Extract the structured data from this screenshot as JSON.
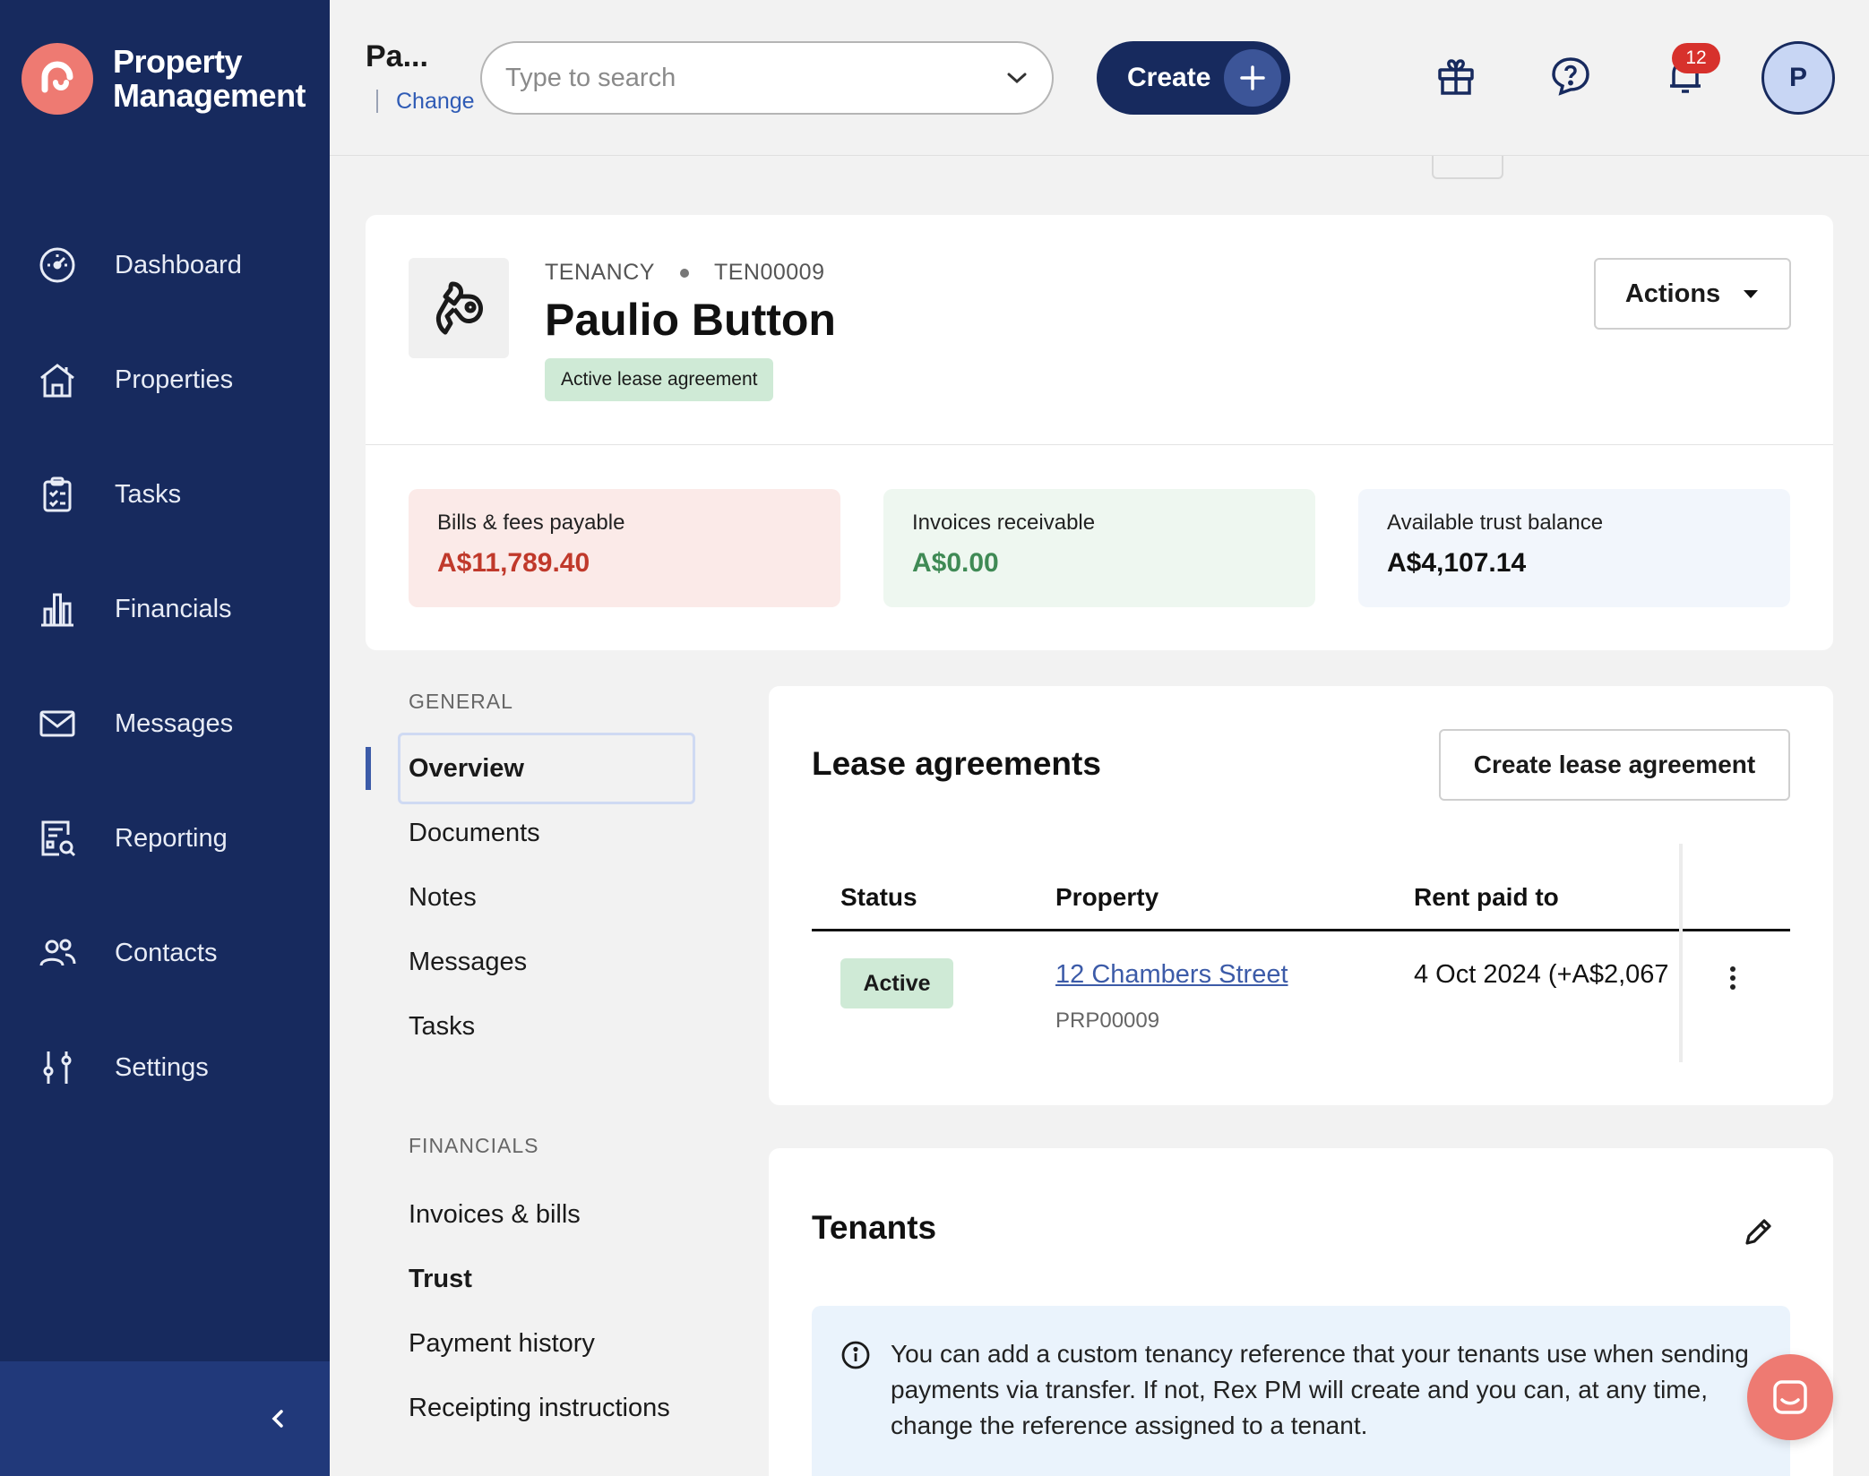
{
  "brand": {
    "line1": "Property",
    "line2": "Management"
  },
  "sidebar": {
    "items": [
      {
        "label": "Dashboard",
        "icon": "dashboard-icon"
      },
      {
        "label": "Properties",
        "icon": "house-icon"
      },
      {
        "label": "Tasks",
        "icon": "clipboard-icon"
      },
      {
        "label": "Financials",
        "icon": "bar-chart-icon"
      },
      {
        "label": "Messages",
        "icon": "envelope-icon"
      },
      {
        "label": "Reporting",
        "icon": "report-search-icon"
      },
      {
        "label": "Contacts",
        "icon": "people-icon"
      },
      {
        "label": "Settings",
        "icon": "sliders-icon"
      }
    ]
  },
  "header": {
    "context_title": "Pa...",
    "context_change": "Change",
    "search_placeholder": "Type to search",
    "create_label": "Create",
    "notification_count": "12",
    "avatar_initial": "P"
  },
  "record": {
    "type": "TENANCY",
    "code": "TEN00009",
    "name": "Paulio Button",
    "status": "Active lease agreement",
    "actions_label": "Actions",
    "stats": [
      {
        "label": "Bills & fees payable",
        "value": "A$11,789.40",
        "color": "#c0392b",
        "bg": "#fbeae8"
      },
      {
        "label": "Invoices receivable",
        "value": "A$0.00",
        "color": "#3f8a55",
        "bg": "#eef7f0"
      },
      {
        "label": "Available trust balance",
        "value": "A$4,107.14",
        "color": "#111111",
        "bg": "#f2f6fc"
      }
    ]
  },
  "subnav": {
    "general_heading": "GENERAL",
    "general": [
      "Overview",
      "Documents",
      "Notes",
      "Messages",
      "Tasks"
    ],
    "financials_heading": "FINANCIALS",
    "financials": [
      "Invoices & bills",
      "Trust",
      "Payment history",
      "Receipting instructions"
    ]
  },
  "lease": {
    "title": "Lease agreements",
    "create_label": "Create lease agreement",
    "columns": [
      "Status",
      "Property",
      "Rent paid to"
    ],
    "rows": [
      {
        "status": "Active",
        "property": "12 Chambers Street",
        "property_code": "PRP00009",
        "rent_paid_to": "4 Oct 2024 (+A$2,067"
      }
    ]
  },
  "tenants": {
    "title": "Tenants",
    "info": "You can add a custom tenancy reference that your tenants use when sending payments via transfer. If not, Rex PM will create and you can, at any time, change the reference assigned to a tenant."
  },
  "colors": {
    "sidebar": "#172a5e",
    "accent": "#ee7a72",
    "link": "#3c5ba8"
  }
}
